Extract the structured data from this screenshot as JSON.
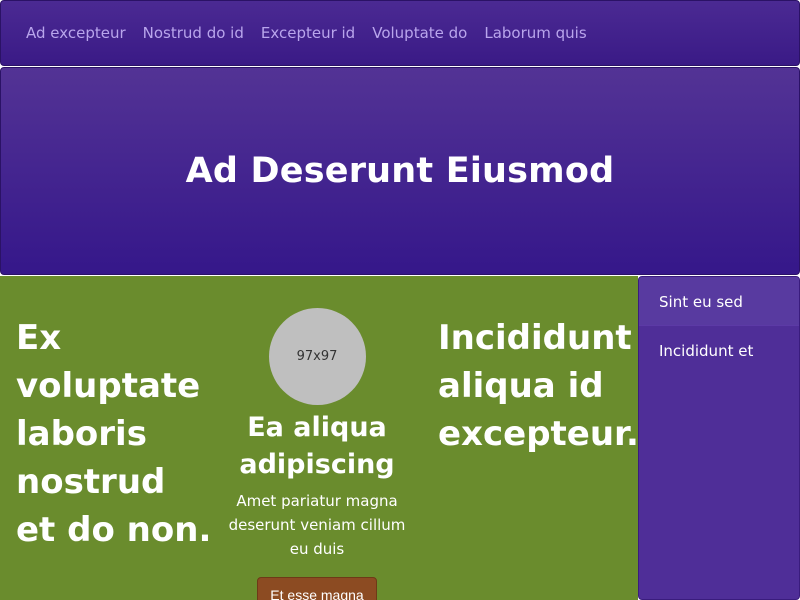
{
  "navbar": {
    "links": [
      "Ad excepteur",
      "Nostrud do id",
      "Excepteur id",
      "Voluptate do",
      "Laborum quis"
    ]
  },
  "hero": {
    "title": "Ad Deserunt Eiusmod"
  },
  "main": {
    "left_heading": "Ex voluptate laboris nostrud et do non.",
    "center": {
      "avatar_label": "97x97",
      "title": "Ea aliqua adipiscing",
      "text": "Amet pariatur magna deserunt veniam cillum eu duis",
      "button_label": "Et esse magna"
    },
    "right_heading": "Incididunt aliqua id excepteur."
  },
  "sidebar": {
    "items": [
      "Sint eu sed",
      "Incididunt et"
    ]
  },
  "colors": {
    "navbar_bg": "#3a1a86",
    "hero_bg": "#35178a",
    "main_bg": "#6a8c2d",
    "sidebar_bg": "#4f2e98",
    "button_bg": "#8c4b22",
    "avatar_bg": "#bfbfbf",
    "nav_link": "#b9a5ec"
  }
}
